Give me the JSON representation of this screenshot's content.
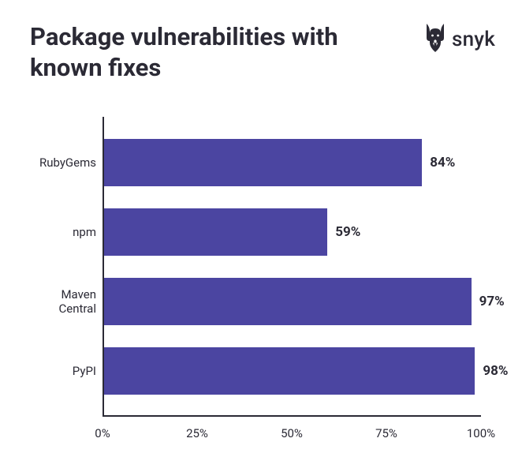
{
  "header": {
    "title": "Package vulnerabilities with known fixes",
    "brand": "snyk"
  },
  "chart_data": {
    "type": "bar",
    "orientation": "horizontal",
    "categories": [
      "RubyGems",
      "npm",
      "Maven Central",
      "PyPI"
    ],
    "values": [
      84,
      59,
      97,
      98
    ],
    "value_labels": [
      "84%",
      "59%",
      "97%",
      "98%"
    ],
    "title": "Package vulnerabilities with known fixes",
    "xlabel": "",
    "ylabel": "",
    "xlim": [
      0,
      100
    ],
    "x_ticks": [
      0,
      25,
      50,
      75,
      100
    ],
    "x_tick_labels": [
      "0%",
      "25%",
      "50%",
      "75%",
      "100%"
    ],
    "bar_color": "#4b45a1"
  }
}
